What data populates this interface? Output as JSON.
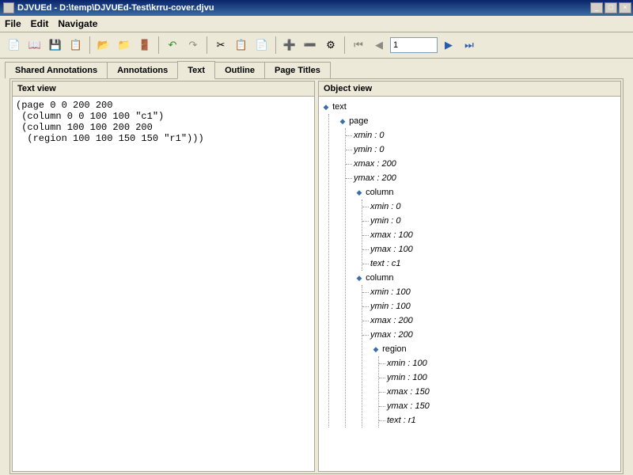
{
  "titlebar": {
    "text": "DJVUEd - D:\\temp\\DJVUEd-Test\\krru-cover.djvu"
  },
  "menu": {
    "file": "File",
    "edit": "Edit",
    "navigate": "Navigate"
  },
  "toolbar": {
    "page_value": "1"
  },
  "tabs": {
    "shared": "Shared Annotations",
    "annotations": "Annotations",
    "text": "Text",
    "outline": "Outline",
    "page_titles": "Page Titles"
  },
  "panes": {
    "text_view": "Text view",
    "object_view": "Object view"
  },
  "text_content": {
    "l1": "(page 0 0 200 200",
    "l2": " (column 0 0 100 100 \"c1\")",
    "l3": " (column 100 100 200 200",
    "l4": "  (region 100 100 150 150 \"r1\")))"
  },
  "tree": {
    "text": "text",
    "page": "page",
    "column": "column",
    "region": "region",
    "p_xmin": "xmin : 0",
    "p_ymin": "ymin : 0",
    "p_xmax": "xmax : 200",
    "p_ymax": "ymax : 200",
    "c1_xmin": "xmin : 0",
    "c1_ymin": "ymin : 0",
    "c1_xmax": "xmax : 100",
    "c1_ymax": "ymax : 100",
    "c1_text": "text : c1",
    "c2_xmin": "xmin : 100",
    "c2_ymin": "ymin : 100",
    "c2_xmax": "xmax : 200",
    "c2_ymax": "ymax : 200",
    "r_xmin": "xmin : 100",
    "r_ymin": "ymin : 100",
    "r_xmax": "xmax : 150",
    "r_ymax": "ymax : 150",
    "r_text": "text : r1"
  }
}
